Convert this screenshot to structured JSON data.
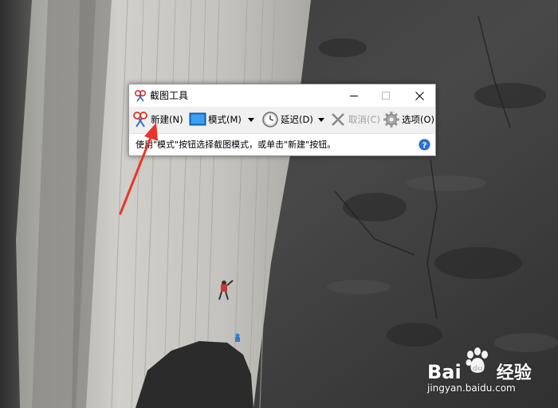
{
  "window": {
    "title": "截图工具",
    "controls": {
      "minimize": "minimize-icon",
      "maximize": "maximize-icon",
      "close": "close-icon"
    }
  },
  "toolbar": {
    "new_label": "新建(N)",
    "mode_label": "模式(M)",
    "delay_label": "延迟(D)",
    "cancel_label": "取消(C)",
    "cancel_disabled": true,
    "options_label": "选项(O)"
  },
  "status": {
    "message": "使用\"模式\"按钮选择截图模式，或单击\"新建\"按钮。",
    "help_icon": "help-icon"
  },
  "annotation": {
    "color": "#e8352b",
    "target": "new-button"
  },
  "watermark": {
    "brand": "Bai",
    "brand_suffix": "经验",
    "url": "jingyan.baidu.com"
  },
  "colors": {
    "window_bg": "#f0f0f0",
    "accent_blue": "#1e7fd8",
    "disabled_text": "#a0a0a0"
  }
}
